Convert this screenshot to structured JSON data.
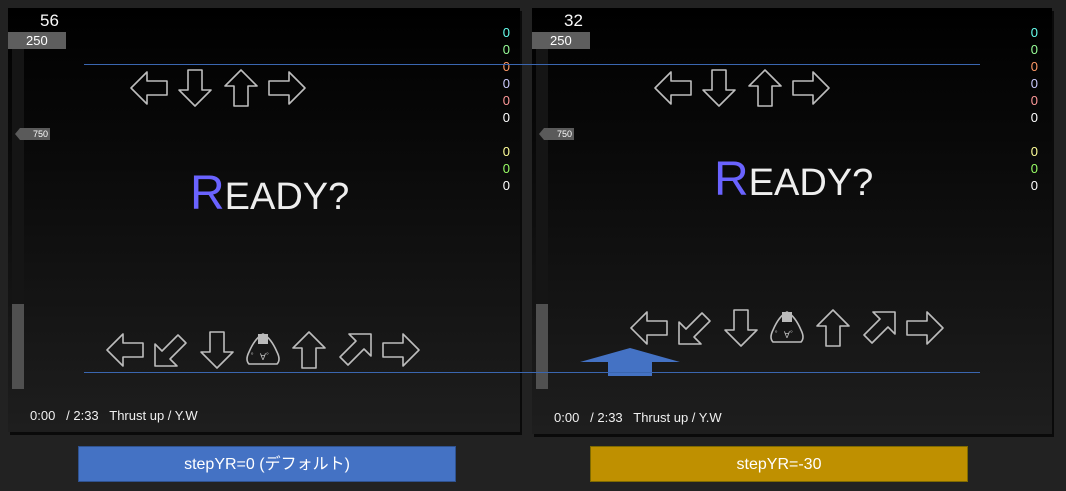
{
  "left": {
    "combo": "56",
    "gauge_max": "250",
    "gauge_marker": "750",
    "gauge_level": 0.25,
    "judgments": [
      "0",
      "0",
      "0",
      "0",
      "0",
      "0",
      "0",
      "0",
      "0"
    ],
    "ready": {
      "cap": "R",
      "rest": "EADY?"
    },
    "music": "0:00   / 2:33   Thrust up / Y.W",
    "top_arrows": [
      "left-arrow-icon",
      "down-arrow-icon",
      "up-arrow-icon",
      "right-arrow-icon"
    ],
    "bottom_arrows": [
      "left-arrow-icon",
      "down-left-arrow-icon",
      "down-arrow-icon",
      "onigiri-icon",
      "up-arrow-icon",
      "up-right-arrow-icon",
      "right-arrow-icon"
    ]
  },
  "right": {
    "combo": "32",
    "gauge_max": "250",
    "gauge_marker": "750",
    "gauge_level": 0.25,
    "judgments": [
      "0",
      "0",
      "0",
      "0",
      "0",
      "0",
      "0",
      "0",
      "0"
    ],
    "ready": {
      "cap": "R",
      "rest": "EADY?"
    },
    "music": "0:00   / 2:33   Thrust up / Y.W",
    "top_arrows": [
      "left-arrow-icon",
      "down-arrow-icon",
      "up-arrow-icon",
      "right-arrow-icon"
    ],
    "bottom_arrows": [
      "left-arrow-icon",
      "down-left-arrow-icon",
      "down-arrow-icon",
      "onigiri-icon",
      "up-arrow-icon",
      "up-right-arrow-icon",
      "right-arrow-icon"
    ]
  },
  "judgment_colors": [
    "#66ffee",
    "#99ff99",
    "#ff9966",
    "#ccccff",
    "#ff9999",
    "#ffffff",
    "#ffff99",
    "#99ff66",
    "#ffffff"
  ],
  "captions": {
    "left": "stepYR=0 (デフォルト)",
    "right": "stepYR=-30"
  },
  "colors": {
    "blue_caption": "#4472c4",
    "gold_caption": "#bf9000",
    "ready_cap": "#6a63ff",
    "guide_line": "#3a66b0"
  }
}
